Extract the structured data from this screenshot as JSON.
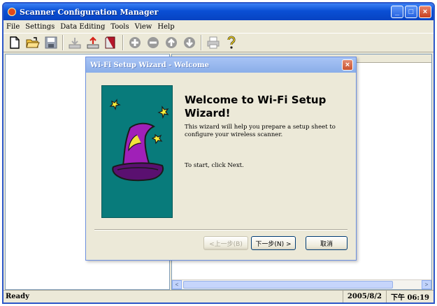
{
  "window": {
    "title": "Scanner Configuration Manager",
    "caption": {
      "minimize": "_",
      "maximize": "□",
      "close": "×"
    }
  },
  "menu": [
    {
      "label": "File"
    },
    {
      "label": "Settings"
    },
    {
      "label": "Data Editing"
    },
    {
      "label": "Tools"
    },
    {
      "label": "View"
    },
    {
      "label": "Help"
    }
  ],
  "toolbar": {
    "icons": [
      "new-file-icon",
      "open-folder-icon",
      "save-icon",
      "download-icon",
      "upload-icon",
      "book-icon",
      "add-icon",
      "remove-icon",
      "up-icon",
      "down-icon",
      "print-icon",
      "help-icon"
    ]
  },
  "dialog": {
    "title": "Wi-Fi Setup Wizard - Welcome",
    "close": "×",
    "heading": "Welcome to Wi-Fi Setup Wizard!",
    "body": "This wizard will help you prepare a setup sheet to configure your wireless scanner.",
    "start_text": "To start, click Next.",
    "buttons": {
      "back": "<上一步(B)",
      "next": "下一步(N) >",
      "cancel": "取消"
    }
  },
  "scroll": {
    "left": "<",
    "right": ">"
  },
  "status": {
    "ready": "Ready",
    "date": "2005/8/2",
    "time": "下午 06:19"
  },
  "colors": {
    "titlebar": "#0a4fd4",
    "dialog_title": "#8aaee8",
    "art_background": "#087b7b"
  }
}
